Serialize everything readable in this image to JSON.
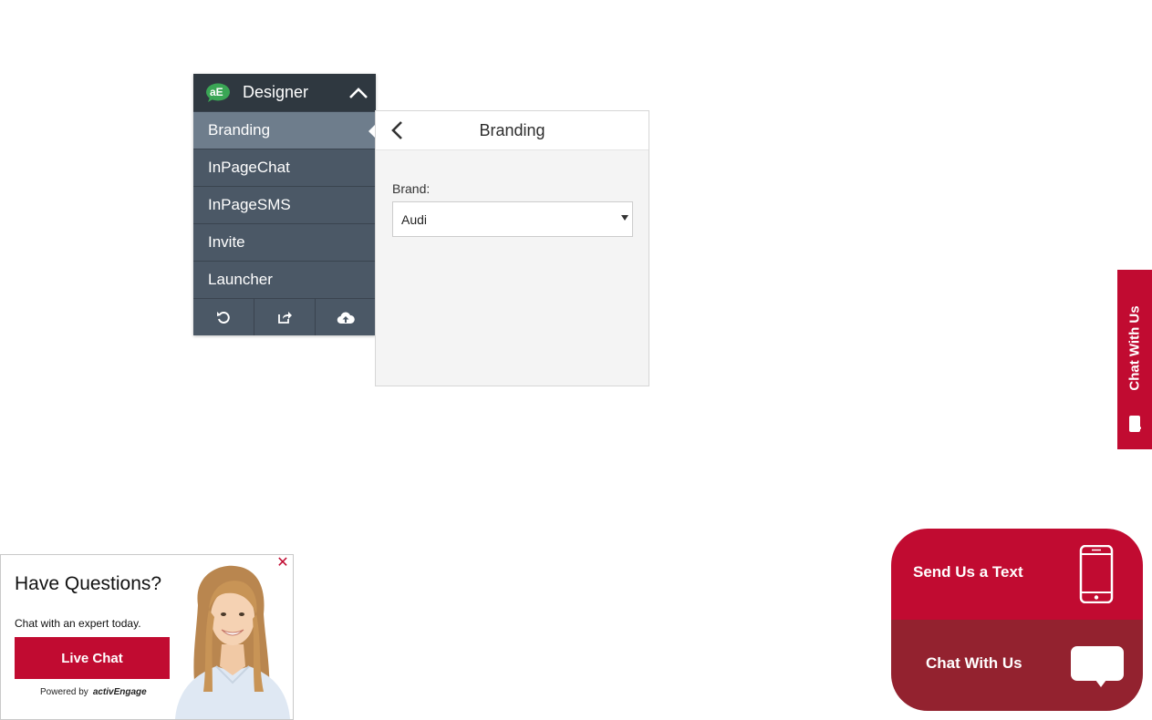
{
  "designer": {
    "title": "Designer",
    "logo_text": "aE",
    "menu": [
      {
        "label": "Branding",
        "active": true
      },
      {
        "label": "InPageChat",
        "active": false
      },
      {
        "label": "InPageSMS",
        "active": false
      },
      {
        "label": "Invite",
        "active": false
      },
      {
        "label": "Launcher",
        "active": false
      }
    ],
    "toolbar_icons": [
      "undo-icon",
      "share-icon",
      "cloud-upload-icon"
    ]
  },
  "branding": {
    "title": "Branding",
    "brand_label": "Brand:",
    "brand_value": "Audi"
  },
  "vertical_tab": {
    "label": "Chat With Us"
  },
  "invite": {
    "heading": "Have Questions?",
    "subtext": "Chat with an expert today.",
    "button_label": "Live Chat",
    "powered_by": "Powered by",
    "powered_brand": "activEngage",
    "close_symbol": "✕"
  },
  "launcher": {
    "text_label": "Send Us a Text",
    "chat_label": "Chat With Us"
  },
  "colors": {
    "brand_red": "#c10b31",
    "dark_red": "#93222f",
    "panel_dark": "#2f3840",
    "panel_mid": "#4b5866",
    "panel_active": "#6e7d8c",
    "logo_green": "#3aa655"
  }
}
